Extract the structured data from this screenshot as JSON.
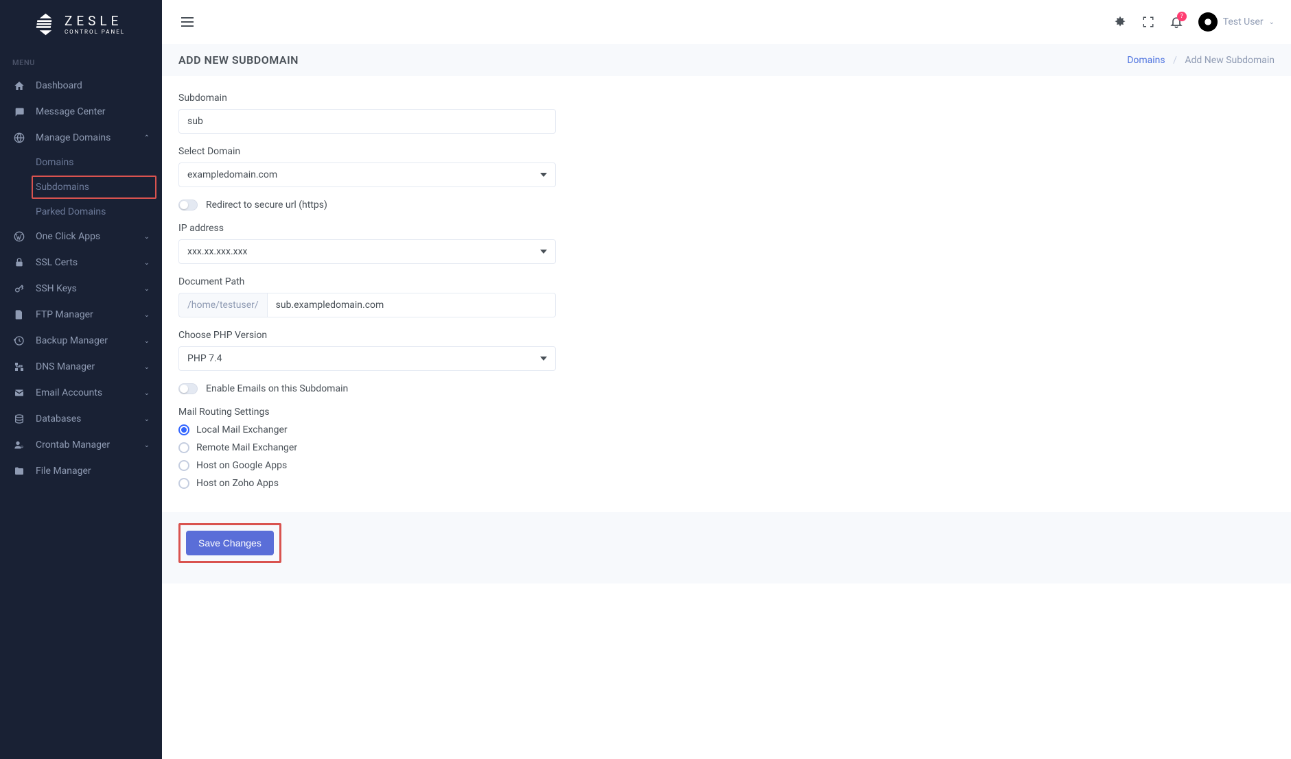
{
  "brand": {
    "name": "ZESLE",
    "subtitle": "CONTROL PANEL"
  },
  "sidebar": {
    "menu_label": "MENU",
    "items": [
      {
        "label": "Dashboard",
        "icon": "home"
      },
      {
        "label": "Message Center",
        "icon": "chat"
      },
      {
        "label": "Manage Domains",
        "icon": "globe",
        "expanded": true,
        "children": [
          {
            "label": "Domains"
          },
          {
            "label": "Subdomains",
            "highlighted": true
          },
          {
            "label": "Parked Domains"
          }
        ]
      },
      {
        "label": "One Click Apps",
        "icon": "wordpress"
      },
      {
        "label": "SSL Certs",
        "icon": "lock"
      },
      {
        "label": "SSH Keys",
        "icon": "key"
      },
      {
        "label": "FTP Manager",
        "icon": "file"
      },
      {
        "label": "Backup Manager",
        "icon": "history"
      },
      {
        "label": "DNS Manager",
        "icon": "network"
      },
      {
        "label": "Email Accounts",
        "icon": "mail"
      },
      {
        "label": "Databases",
        "icon": "database"
      },
      {
        "label": "Crontab Manager",
        "icon": "user-cog"
      },
      {
        "label": "File Manager",
        "icon": "folder"
      }
    ]
  },
  "topbar": {
    "notif_badge": "?",
    "user_name": "Test User"
  },
  "page": {
    "title": "ADD NEW SUBDOMAIN",
    "breadcrumb_root": "Domains",
    "breadcrumb_current": "Add New Subdomain"
  },
  "form": {
    "subdomain_label": "Subdomain",
    "subdomain_value": "sub",
    "domain_label": "Select Domain",
    "domain_value": "exampledomain.com",
    "redirect_label": "Redirect to secure url (https)",
    "ip_label": "IP address",
    "ip_value": "xxx.xx.xxx.xxx",
    "docpath_label": "Document Path",
    "docpath_prefix": "/home/testuser/",
    "docpath_value": "sub.exampledomain.com",
    "php_label": "Choose PHP Version",
    "php_value": "PHP 7.4",
    "emails_label": "Enable Emails on this Subdomain",
    "mail_routing_label": "Mail Routing Settings",
    "mail_options": [
      "Local Mail Exchanger",
      "Remote Mail Exchanger",
      "Host on Google Apps",
      "Host on Zoho Apps"
    ],
    "save_label": "Save Changes"
  }
}
